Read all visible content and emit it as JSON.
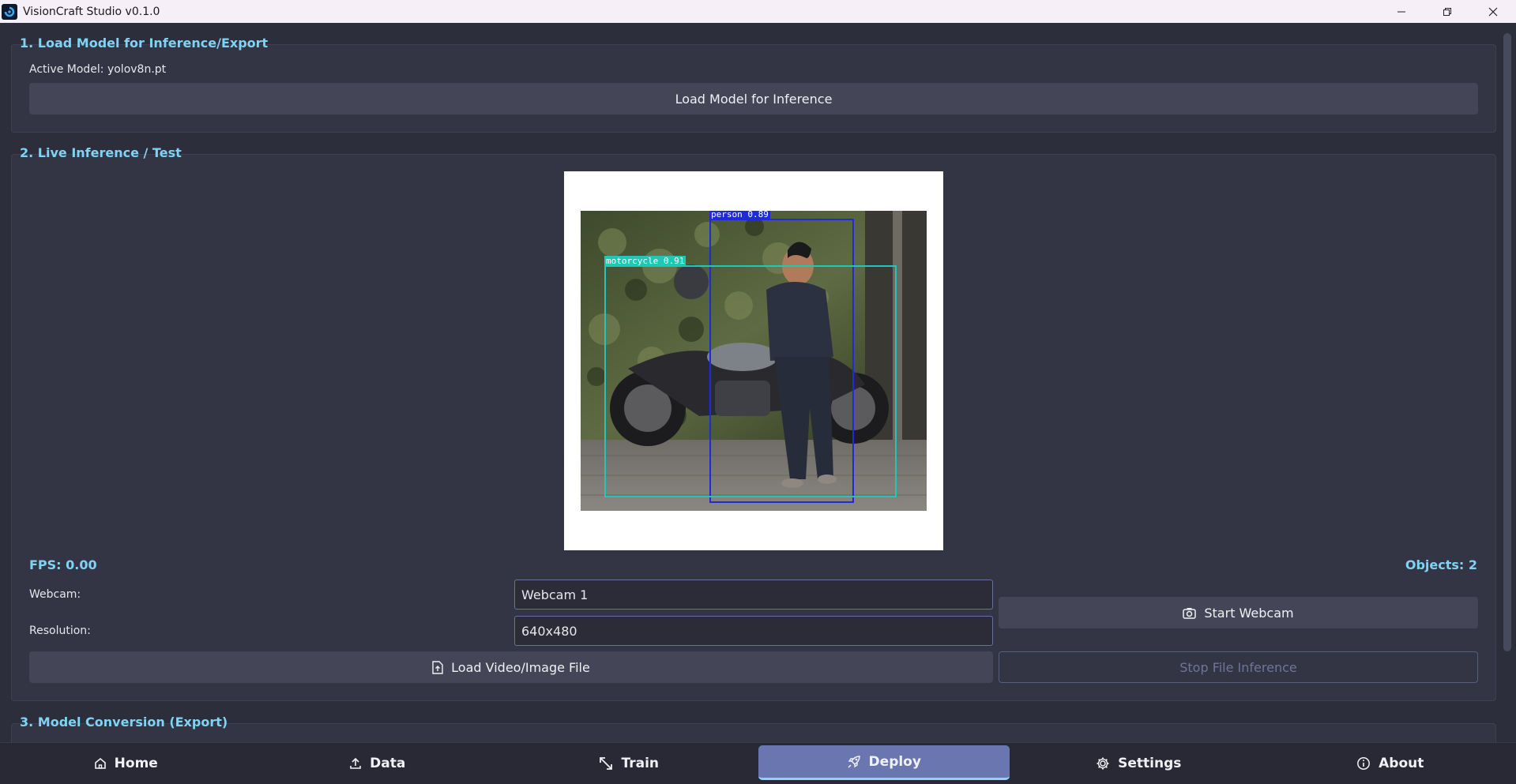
{
  "window": {
    "title": "VisionCraft Studio v0.1.0"
  },
  "section1": {
    "title": "1. Load Model for Inference/Export",
    "active_model": "Active Model: yolov8n.pt",
    "load_button": "Load Model for Inference"
  },
  "section2": {
    "title": "2. Live Inference / Test",
    "detections": [
      {
        "label": "person 0.89",
        "class": "person",
        "confidence": 0.89,
        "color": "#1e2bd8"
      },
      {
        "label": "motorcycle 0.91",
        "class": "motorcycle",
        "confidence": 0.91,
        "color": "#1ec8b4"
      }
    ],
    "fps": "FPS: 0.00",
    "objects": "Objects: 2",
    "webcam_label": "Webcam:",
    "webcam_value": "Webcam 1",
    "resolution_label": "Resolution:",
    "resolution_value": "640x480",
    "start_webcam": "Start Webcam",
    "load_file": "Load Video/Image File",
    "stop_file": "Stop File Inference"
  },
  "section3": {
    "title": "3. Model Conversion (Export)"
  },
  "nav": {
    "items": [
      {
        "label": "Home",
        "icon": "home-icon"
      },
      {
        "label": "Data",
        "icon": "upload-icon"
      },
      {
        "label": "Train",
        "icon": "expand-icon"
      },
      {
        "label": "Deploy",
        "icon": "rocket-icon",
        "active": true
      },
      {
        "label": "Settings",
        "icon": "gear-icon"
      },
      {
        "label": "About",
        "icon": "info-icon"
      }
    ]
  },
  "colors": {
    "accent": "#7fd3f5",
    "background": "#2d2e3b",
    "nav_active": "#6a76b0"
  }
}
